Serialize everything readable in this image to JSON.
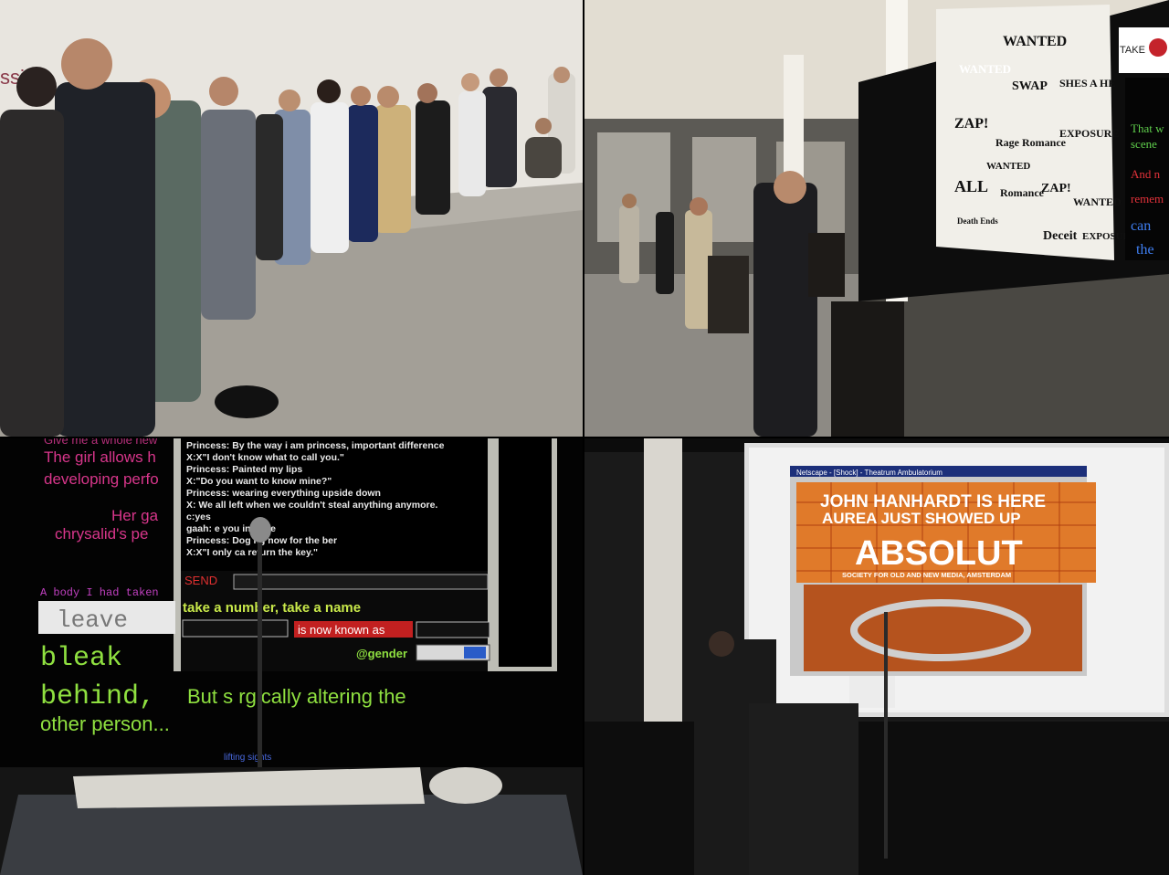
{
  "panel1": {
    "wall_text": "ssi"
  },
  "panel2": {
    "screen_words": [
      "WANTED",
      "WANTED",
      "SWAP",
      "SHES A HE",
      "ZAP!",
      "Rage Romance",
      "EXPOSURE",
      "ALL",
      "WANTED",
      "Romance",
      "ZAP!",
      "WANTED",
      "Deceit",
      "EXPOSURE",
      "Death Ends"
    ],
    "logo_text": "TAKE",
    "side_text": [
      "That w",
      "scene",
      "And n",
      "remem",
      "can",
      "the"
    ]
  },
  "panel3": {
    "left_text": [
      "Give me a whole new",
      "The girl allows h",
      "developing perfo",
      "Her ga",
      "chrysalid's pe"
    ],
    "chat_lines": [
      "Princess: By the way i am princess, important difference",
      "X:X\"I don't know what to call you.\"",
      "Princess: Painted my lips",
      "X:\"Do you want to know mine?\"",
      "Princess: wearing everything upside down",
      "X: We all left when we couldn't steal anything anymore.",
      "c:yes",
      "gaah: e you in state",
      "Princess: Dog ng now for the ber",
      "X:X\"I only ca return the key.\""
    ],
    "send_label": "SEND",
    "take_number": "take a number, take a name",
    "now_known": "is now known as",
    "gender_label": "@gender",
    "body_line": "A body I had taken",
    "leave_word": "leave",
    "bleak": "bleak",
    "behind": "behind,",
    "surgical": "But s rgically altering the",
    "other_person": "other person...",
    "bottom_link": "lifting sights"
  },
  "panel4": {
    "browser_title": "Netscape - [Shock] - Theatrum Ambulatorium",
    "headline1": "JOHN HANHARDT IS HERE",
    "headline2": "AUREA JUST SHOWED UP",
    "big": "ABSOLUT",
    "sub": "SOCIETY FOR OLD AND NEW MEDIA, AMSTERDAM"
  }
}
